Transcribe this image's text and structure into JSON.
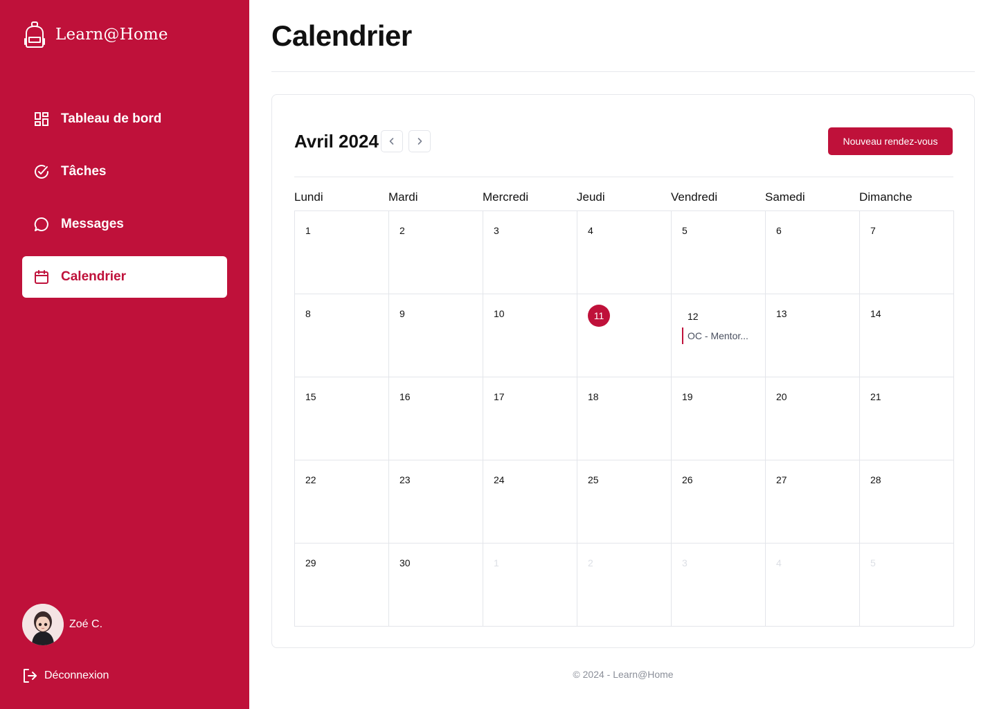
{
  "brand": {
    "name": "Learn@Home",
    "icon": "backpack-icon"
  },
  "sidebar": {
    "items": [
      {
        "label": "Tableau de bord",
        "icon": "dashboard-icon",
        "active": false
      },
      {
        "label": "Tâches",
        "icon": "check-circle-icon",
        "active": false
      },
      {
        "label": "Messages",
        "icon": "message-icon",
        "active": false
      },
      {
        "label": "Calendrier",
        "icon": "calendar-icon",
        "active": true
      }
    ],
    "user": {
      "name": "Zoé C."
    },
    "logout_label": "Déconnexion"
  },
  "page": {
    "title": "Calendrier"
  },
  "calendar": {
    "month_label": "Avril 2024",
    "new_button_label": "Nouveau rendez-vous",
    "weekdays": [
      "Lundi",
      "Mardi",
      "Mercredi",
      "Jeudi",
      "Vendredi",
      "Samedi",
      "Dimanche"
    ],
    "today": 11,
    "days": [
      "1",
      "2",
      "3",
      "4",
      "5",
      "6",
      "7",
      "8",
      "9",
      "10",
      "11",
      "12",
      "13",
      "14",
      "15",
      "16",
      "17",
      "18",
      "19",
      "20",
      "21",
      "22",
      "23",
      "24",
      "25",
      "26",
      "27",
      "28",
      "29",
      "30",
      "1",
      "2",
      "3",
      "4",
      "5"
    ],
    "muted_from_index": 30,
    "today_index": 10,
    "events": [
      {
        "day_index": 11,
        "label": "OC - Mentor..."
      }
    ]
  },
  "colors": {
    "accent": "#bf113a",
    "border": "#e3e5ea"
  },
  "footer": {
    "text": "© 2024 - Learn@Home"
  }
}
